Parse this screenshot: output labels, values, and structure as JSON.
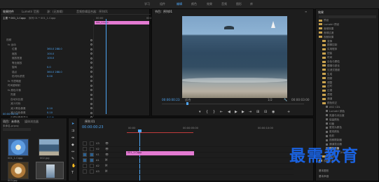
{
  "workspaces": [
    "学习",
    "组件",
    "编辑",
    "颜色",
    "效果",
    "音频",
    "图形",
    "库"
  ],
  "effect_controls": {
    "tabs": [
      "效果控件",
      "Lumetri 范围",
      "源：(无剪辑)",
      "音频剪辑混合器：序列01"
    ],
    "source": "主要 * 001_1.Cqpp",
    "sequence": "序列 01 * 001_1.Cqpp",
    "clip_label": "001_1.Cqpp",
    "timecode_start": "00:00",
    "timecode_end": "00:00",
    "rows": [
      {
        "label": "视频",
        "value": ""
      },
      {
        "label": "fx 运动",
        "value": ""
      },
      {
        "label": "位置",
        "value": "360.0  288.0"
      },
      {
        "label": "缩放",
        "value": "100.0"
      },
      {
        "label": "缩放宽度",
        "value": "100.0"
      },
      {
        "label": "等比缩放",
        "value": ""
      },
      {
        "label": "旋转",
        "value": "0.0"
      },
      {
        "label": "锚点",
        "value": "360.0  288.0"
      },
      {
        "label": "防闪烁滤镜",
        "value": "0.00"
      },
      {
        "label": "fx 不透明度",
        "value": ""
      },
      {
        "label": "时间重映射",
        "value": ""
      },
      {
        "label": "fx 颜色平衡",
        "value": ""
      },
      {
        "label": "亮度",
        "value": ""
      },
      {
        "label": "自动对比度",
        "value": ""
      },
      {
        "label": "减少闪烁",
        "value": ""
      },
      {
        "label": "减少黑色像素",
        "value": "0.10"
      },
      {
        "label": "减少白色像素",
        "value": "0.10"
      },
      {
        "label": "与原始图像混合",
        "value": "0.0 %"
      }
    ],
    "footer_timecode": "00:00:00:00"
  },
  "program_monitor": {
    "title": "节目：序列01",
    "timecode_left": "00:00:00:23",
    "fit": "适合",
    "ratio": "1/2",
    "timecode_right": "00:00:03:00"
  },
  "project": {
    "tabs": [
      "项目：未命名",
      "媒体浏览器"
    ],
    "name": "未命名.prproj",
    "items": [
      {
        "name": "001_1.Cqpp"
      },
      {
        "name": "002.jpg"
      },
      {
        "name": "003.jpg"
      },
      {
        "name": "004.jpg"
      }
    ]
  },
  "timeline": {
    "title": "序列 01",
    "timecode": "00:00:00:23",
    "ruler": [
      "00:00",
      "00:00:05:00",
      "00:00:10:00"
    ],
    "tracks": [
      "V3",
      "V2",
      "V1",
      "A1",
      "A2",
      "A3"
    ],
    "clip": "001_1.Cqpp"
  },
  "effects_panel": {
    "title": "效果",
    "items": [
      "预设",
      "Lumetri 预设",
      "音频效果",
      "音频过渡",
      "视频效果",
      "变换",
      "图像控制",
      "实用程序",
      "扭曲",
      "时间",
      "杂色与颗粒",
      "模糊与锐化",
      "沉浸式视频",
      "生成",
      "视频",
      "调整",
      "过时",
      "过渡",
      "透视",
      "通道",
      "颜色校正",
      "ASC CDL",
      "Lumetri 颜色",
      "亮度与对比度",
      "保留颜色",
      "均衡",
      "更改为颜色",
      "更改颜色",
      "色彩",
      "视频限制器",
      "通道混合器",
      "颜色平衡",
      "颜色平衡 (HLS)",
      "风格化",
      "视频过渡"
    ],
    "bottom": [
      "基本图形",
      "基本声音"
    ]
  },
  "watermark": "最需教育",
  "colors": {
    "accent": "#4ea6f5",
    "clip": "#e37ad2",
    "playhead": "#4ea6f5",
    "watermark": "#1a62e0"
  }
}
